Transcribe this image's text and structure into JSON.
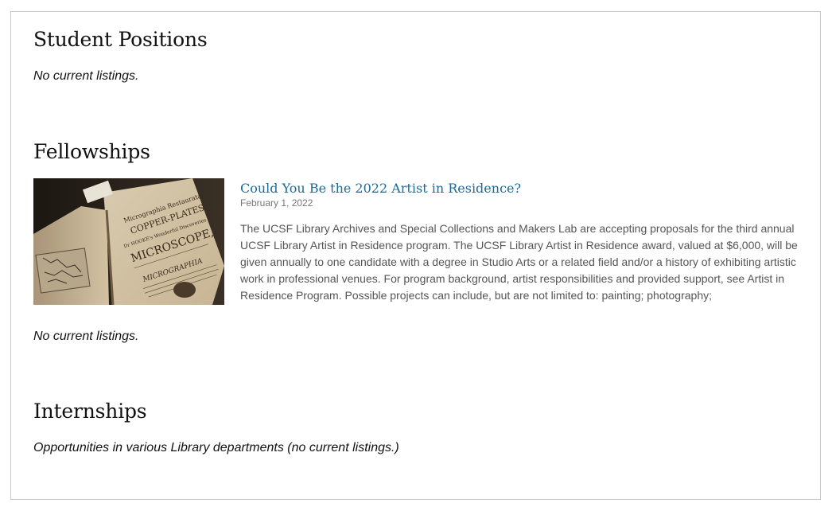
{
  "sections": {
    "student": {
      "heading": "Student Positions",
      "note": "No current listings."
    },
    "fellowships": {
      "heading": "Fellowships",
      "card": {
        "title": "Could You Be the 2022 Artist in Residence?",
        "date": "February 1, 2022",
        "excerpt": "The UCSF Library Archives and Special Collections and Makers Lab are accepting proposals for the third annual UCSF Library Artist in Residence program. The UCSF Library Artist in Residence award, valued at $6,000, will be given annually to one candidate with a degree in Studio Arts or a related field and/or a history of exhibiting artistic work in professional venues. For program background, artist responsibilities and provided support, see Artist in Residence Program. Possible projects can include, but are not limited to: painting; photography;",
        "image": {
          "book_title_lines": [
            "Micrographia Restaurata",
            "COPPER-PLATES",
            "Dr HOOKE's Wonderful Discoveries",
            "MICROSCOPE,",
            "MICROGRAPHIA"
          ]
        }
      },
      "note": "No current listings."
    },
    "internships": {
      "heading": "Internships",
      "note": "Opportunities in various Library departments (no current listings.)"
    }
  },
  "colors": {
    "link": "#1a6a9a",
    "border": "#c8c8c8",
    "excerpt": "#555555",
    "date": "#777777"
  }
}
